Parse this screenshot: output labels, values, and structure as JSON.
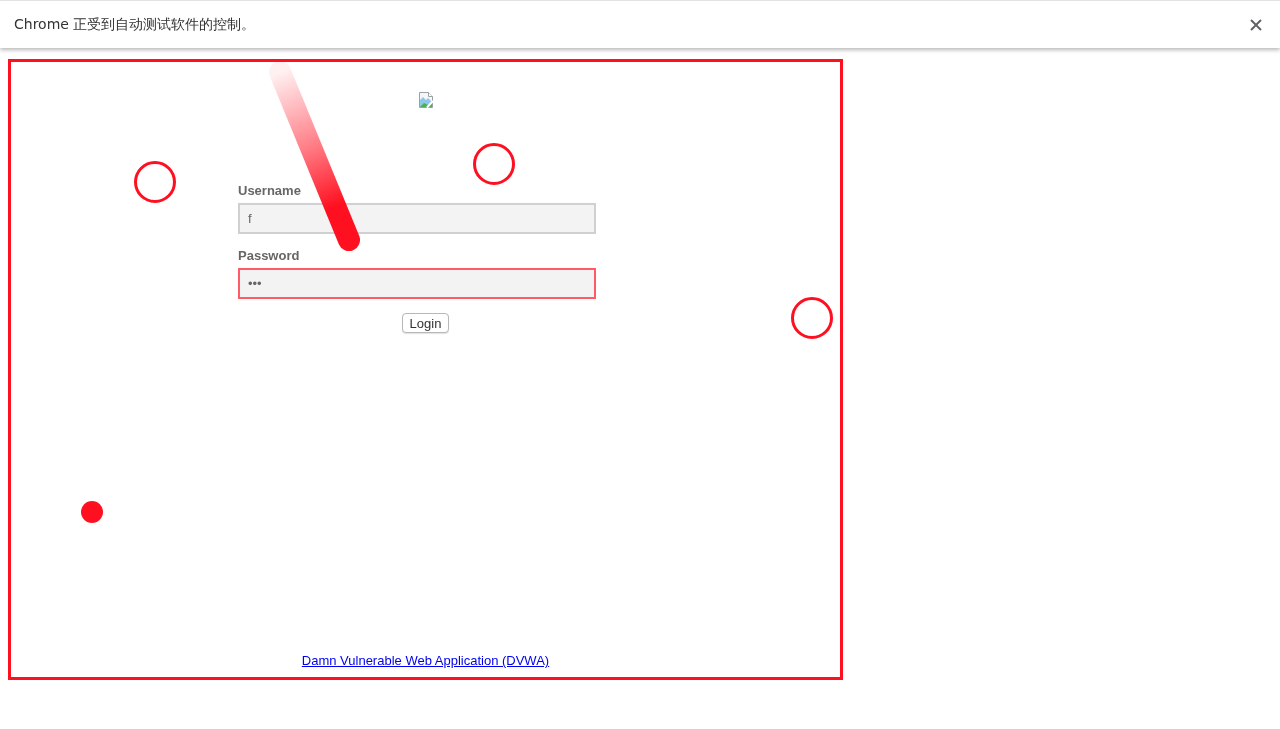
{
  "infobar": {
    "message": "Chrome 正受到自动测试软件的控制。"
  },
  "page": {
    "highlighted": true,
    "form": {
      "fields": [
        {
          "label": "Username",
          "value": "f",
          "highlighted": false
        },
        {
          "label": "Password",
          "value": "•••",
          "highlighted": true
        }
      ],
      "submit_button": "Login"
    },
    "footer_link": "Damn Vulnerable Web Application (DVWA)"
  },
  "overlay_marks": [
    {
      "kind": "trail"
    },
    {
      "kind": "ring"
    },
    {
      "kind": "ring"
    },
    {
      "kind": "ring"
    },
    {
      "kind": "dot"
    }
  ]
}
